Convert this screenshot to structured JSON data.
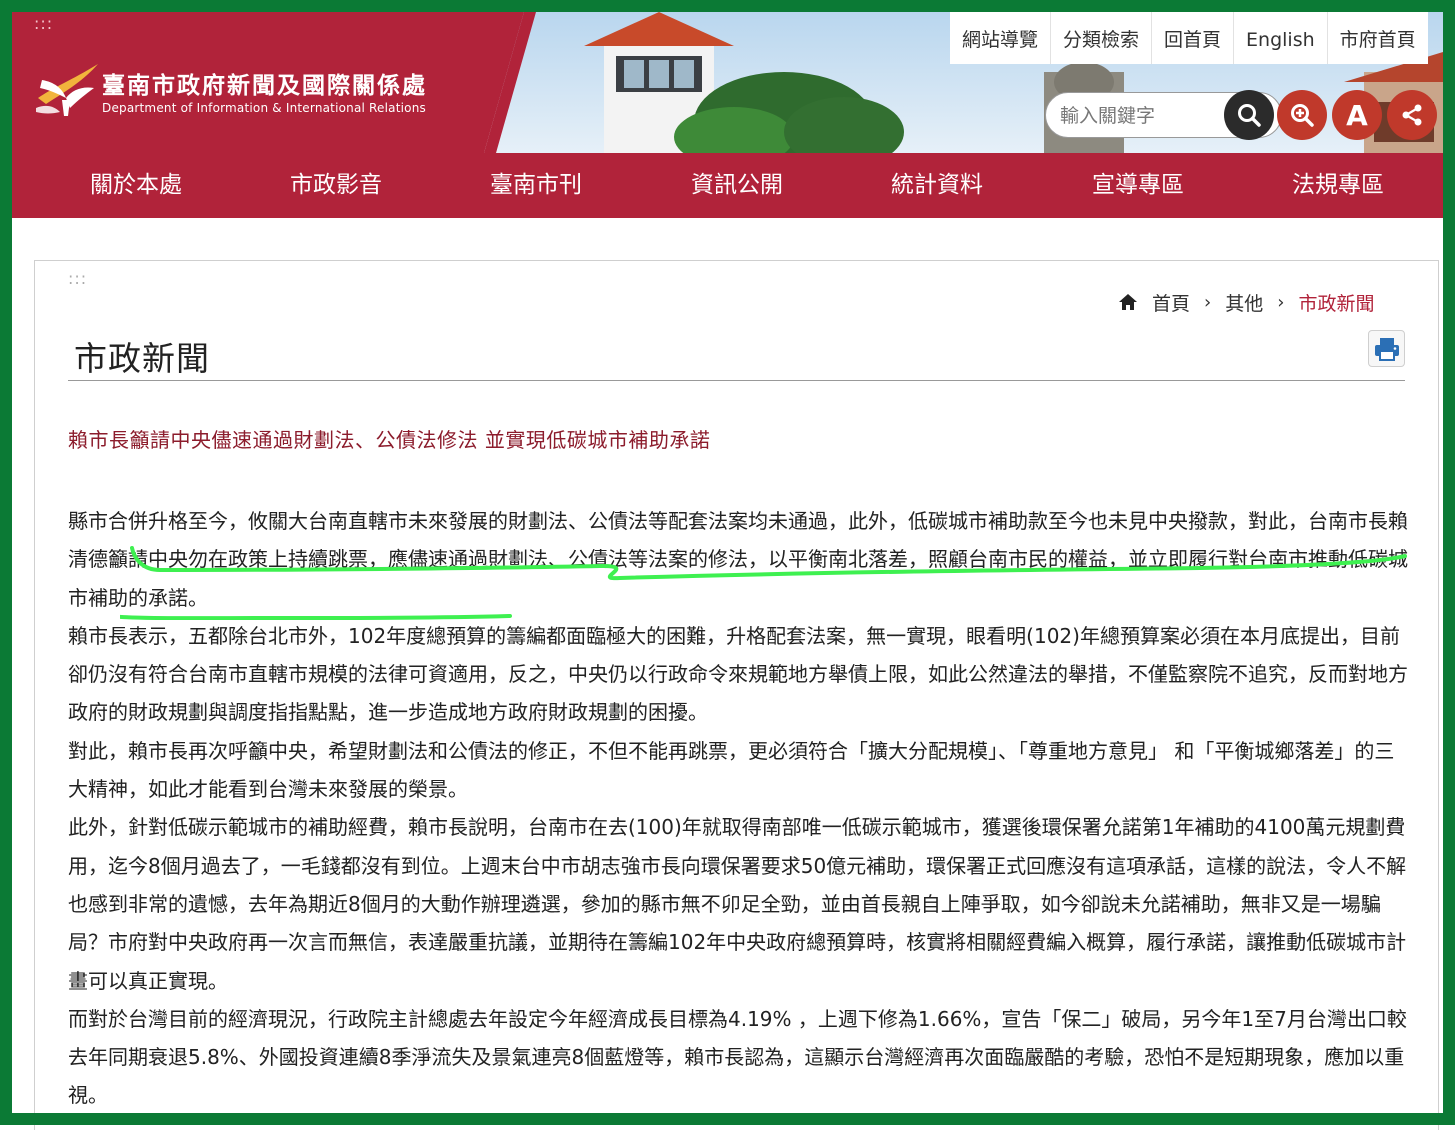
{
  "site": {
    "title": "臺南市政府新聞及國際關係處",
    "subtitle": "Department of Information & International Relations",
    "skip_marker": ":::"
  },
  "utility_nav": [
    {
      "label": "網站導覽"
    },
    {
      "label": "分類檢索"
    },
    {
      "label": "回首頁"
    },
    {
      "label": "English"
    },
    {
      "label": "市府首頁"
    }
  ],
  "search": {
    "placeholder": "輸入關鍵字"
  },
  "font_button": {
    "label": "A"
  },
  "main_nav": [
    {
      "label": "關於本處"
    },
    {
      "label": "市政影音"
    },
    {
      "label": "臺南市刊"
    },
    {
      "label": "資訊公開"
    },
    {
      "label": "統計資料"
    },
    {
      "label": "宣導專區"
    },
    {
      "label": "法規專區"
    }
  ],
  "content": {
    "skip_marker": ":::",
    "breadcrumb": [
      {
        "label": "首頁"
      },
      {
        "label": "其他"
      },
      {
        "label": "市政新聞"
      }
    ],
    "breadcrumb_sep": "›",
    "page_title": "市政新聞",
    "article_title": "賴市長籲請中央儘速通過財劃法、公債法修法 並實現低碳城市補助承諾",
    "paragraphs": [
      "縣市合併升格至今，攸關大台南直轄市未來發展的財劃法、公債法等配套法案均未通過，此外，低碳城市補助款至今也未見中央撥款，對此，台南市長賴清德籲請中央勿在政策上持續跳票，應儘速通過財劃法、公債法等法案的修法，以平衡南北落差，照顧台南市民的權益，並立即履行對台南市推動低碳城市補助的承諾。",
      "賴市長表示，五都除台北市外，102年度總預算的籌編都面臨極大的困難，升格配套法案，無一實現，眼看明(102)年總預算案必須在本月底提出，目前卻仍沒有符合台南市直轄市規模的法律可資適用，反之，中央仍以行政命令來規範地方舉債上限，如此公然違法的舉措，不僅監察院不追究，反而對地方政府的財政規劃與調度指指點點，進一步造成地方政府財政規劃的困擾。",
      "對此，賴市長再次呼籲中央，希望財劃法和公債法的修正，不但不能再跳票，更必須符合「擴大分配規模」、「尊重地方意見」 和「平衡城鄉落差」的三大精神，如此才能看到台灣未來發展的榮景。",
      "此外，針對低碳示範城市的補助經費，賴市長說明，台南市在去(100)年就取得南部唯一低碳示範城市，獲選後環保署允諾第1年補助的4100萬元規劃費用，迄今8個月過去了，一毛錢都沒有到位。上週末台中市胡志強市長向環保署要求50億元補助，環保署正式回應沒有這項承話，這樣的說法，令人不解也感到非常的遺憾，去年為期近8個月的大動作辦理遴選，參加的縣市無不卯足全勁，並由首長親自上陣爭取，如今卻說未允諾補助，無非又是一場騙局？市府對中央政府再一次言而無信，表達嚴重抗議，並期待在籌編102年中央政府總預算時，核實將相關經費編入概算，履行承諾，讓推動低碳城市計畫可以真正實現。",
      "而對於台灣目前的經濟現況，行政院主計總處去年設定今年經濟成長目標為4.19% ，上週下修為1.66%，宣告「保二」破局，另今年1至7月台灣出口較去年同期衰退5.8%、外國投資連續8季淨流失及景氣連亮8個藍燈等，賴市長認為，這顯示台灣經濟再次面臨嚴酷的考驗，恐怕不是短期現象，應加以重視。"
    ]
  },
  "colors": {
    "brand_red": "#b1233a",
    "title_red": "#8c1c2c",
    "frame_green": "#0b7a35",
    "highlight_green": "#3ef050"
  }
}
